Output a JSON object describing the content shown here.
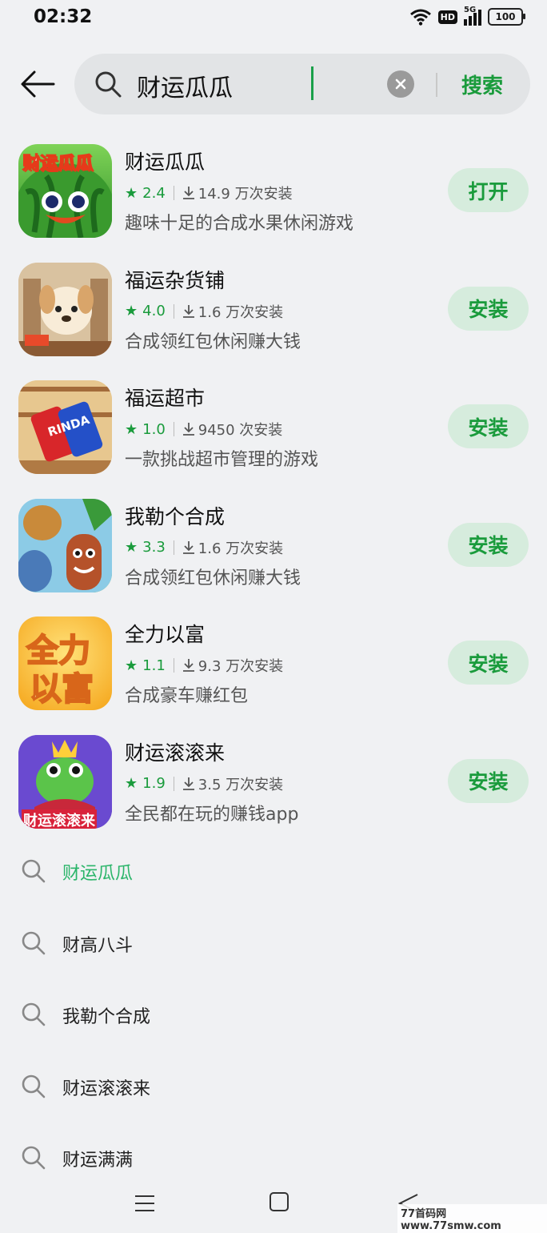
{
  "status_bar": {
    "time": "02:32",
    "hd": "HD",
    "network": "5G",
    "battery": "100"
  },
  "search": {
    "query": "财运瓜瓜",
    "submit_label": "搜索"
  },
  "apps": [
    {
      "name": "财运瓜瓜",
      "rating": "2.4",
      "installs": "14.9 万次安装",
      "desc": "趣味十足的合成水果休闲游戏",
      "action": "打开",
      "icon_text": "财运瓜瓜"
    },
    {
      "name": "福运杂货铺",
      "rating": "4.0",
      "installs": "1.6 万次安装",
      "desc": "合成领红包休闲赚大钱",
      "action": "安装"
    },
    {
      "name": "福运超市",
      "rating": "1.0",
      "installs": "9450 次安装",
      "desc": "一款挑战超市管理的游戏",
      "action": "安装",
      "icon_text": "RINDA"
    },
    {
      "name": "我勒个合成",
      "rating": "3.3",
      "installs": "1.6 万次安装",
      "desc": "合成领红包休闲赚大钱",
      "action": "安装"
    },
    {
      "name": "全力以富",
      "rating": "1.1",
      "installs": "9.3 万次安装",
      "desc": "合成豪车赚红包",
      "action": "安装",
      "icon_text_1": "全力",
      "icon_text_2": "以富"
    },
    {
      "name": "财运滚滚来",
      "rating": "1.9",
      "installs": "3.5 万次安装",
      "desc": "全民都在玩的赚钱app",
      "action": "安装",
      "icon_text": "财运滚滚来"
    }
  ],
  "suggestions": [
    "财运瓜瓜",
    "财高八斗",
    "我勒个合成",
    "财运滚滚来",
    "财运满满"
  ],
  "watermark": "77首码网 www.77smw.com",
  "colors": {
    "accent": "#1a9b3c",
    "button_bg": "#d6ecdd",
    "suggestion_highlight": "#2bb56a"
  }
}
